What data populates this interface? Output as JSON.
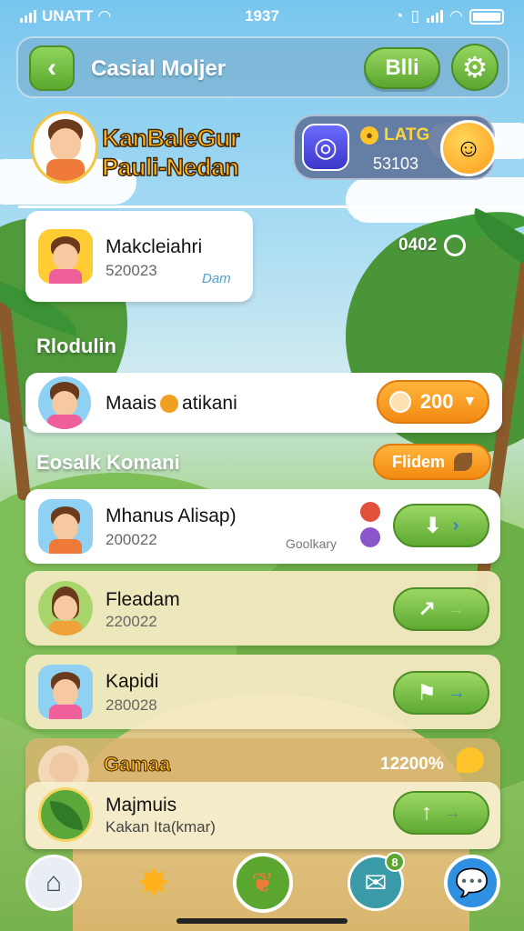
{
  "status_bar": {
    "carrier": "UNATT",
    "time": "1937"
  },
  "header": {
    "title": "Casial Moljer",
    "pill_label": "Blli"
  },
  "profile": {
    "name_line1": "KanBaleGur",
    "name_line2": "Pauli-Nedan",
    "coin_label": "LATG",
    "coin_value": "53103"
  },
  "featured": {
    "name": "Makcleiahri",
    "sub": "520023",
    "tag": "Dam",
    "right_value": "0402"
  },
  "sections": {
    "first": "Rlodulin",
    "second": "Eosalk Komani",
    "second_button": "Flidem"
  },
  "row_single": {
    "name": "Maais",
    "name_suffix": "atikani",
    "pill_value": "200"
  },
  "list": [
    {
      "name": "Mhanus Alisap)",
      "sub": "200022",
      "tag": "Goolkary"
    },
    {
      "name": "Fleadam",
      "sub": "220022"
    },
    {
      "name": "Kapidi",
      "sub": "280028"
    }
  ],
  "gamma": {
    "label": "Gamaa",
    "value": "12200%"
  },
  "last_card": {
    "name": "Majmuis",
    "sub": "Kakan Ita(kmar)"
  },
  "nav": {
    "badge": "8"
  },
  "colors": {
    "accent_green": "#5aa62e",
    "accent_orange": "#f28a12",
    "title_yellow": "#ffb21a"
  }
}
